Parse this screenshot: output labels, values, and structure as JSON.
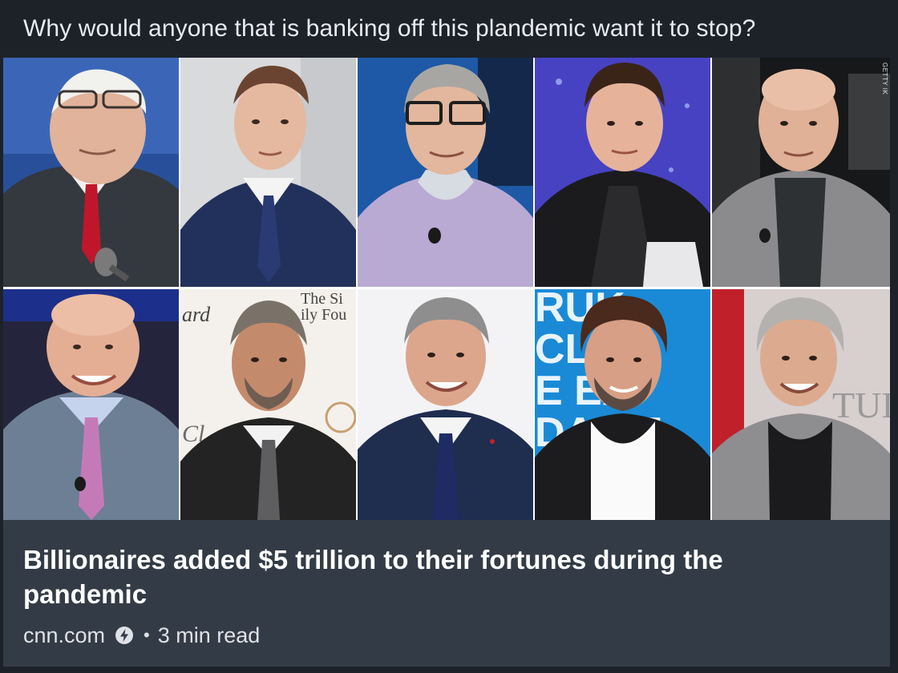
{
  "post": {
    "text": "Why would anyone that is banking off this plandemic want it to stop?"
  },
  "card": {
    "image_credit": "GETTY IK",
    "backdrop_text": {
      "tile_7_top": "The Si",
      "tile_7_mid": "ily Fou",
      "tile_7_left": "ard",
      "tile_7_bottom": "Cl",
      "tile_9": [
        "RUK",
        "CL  ES",
        "E  EA",
        "DA  NT"
      ],
      "tile_10": "TUI"
    },
    "headline": "Billionaires added $5 trillion to their fortunes during the pandemic",
    "source": "cnn.com",
    "separator": "•",
    "read_time": "3 min read"
  },
  "colors": {
    "page_bg": "#1d2229",
    "card_bg": "#333b46",
    "text_primary": "#ffffff",
    "text_secondary": "#dfe2e6"
  },
  "icons": {
    "source_verified": "lightning-bolt-icon"
  }
}
